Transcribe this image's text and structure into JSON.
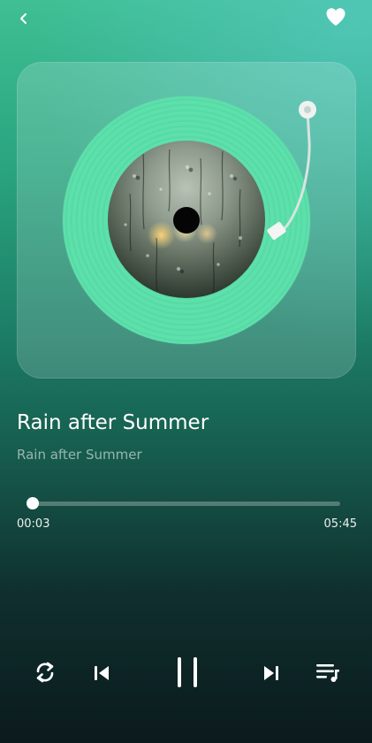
{
  "header": {
    "back_icon": "chevron-left-icon",
    "favorite_icon": "heart-icon",
    "favorited": true
  },
  "colors": {
    "background_top": "#3fbf93",
    "background_bottom": "#0b1a1d",
    "vinyl": "#5de0ab",
    "text_primary": "#ffffff",
    "text_secondary": "#a9c7bd"
  },
  "track": {
    "title": "Rain after Summer",
    "artist": "Rain after Summer",
    "artwork_icon": "rainy-window-artwork"
  },
  "progress": {
    "current_time": "00:03",
    "total_time": "05:45",
    "fraction": 0.009
  },
  "controls": {
    "repeat_icon": "repeat-icon",
    "previous_icon": "skip-previous-icon",
    "play_state": "playing",
    "pause_icon": "pause-icon",
    "next_icon": "skip-next-icon",
    "queue_icon": "playlist-icon"
  }
}
